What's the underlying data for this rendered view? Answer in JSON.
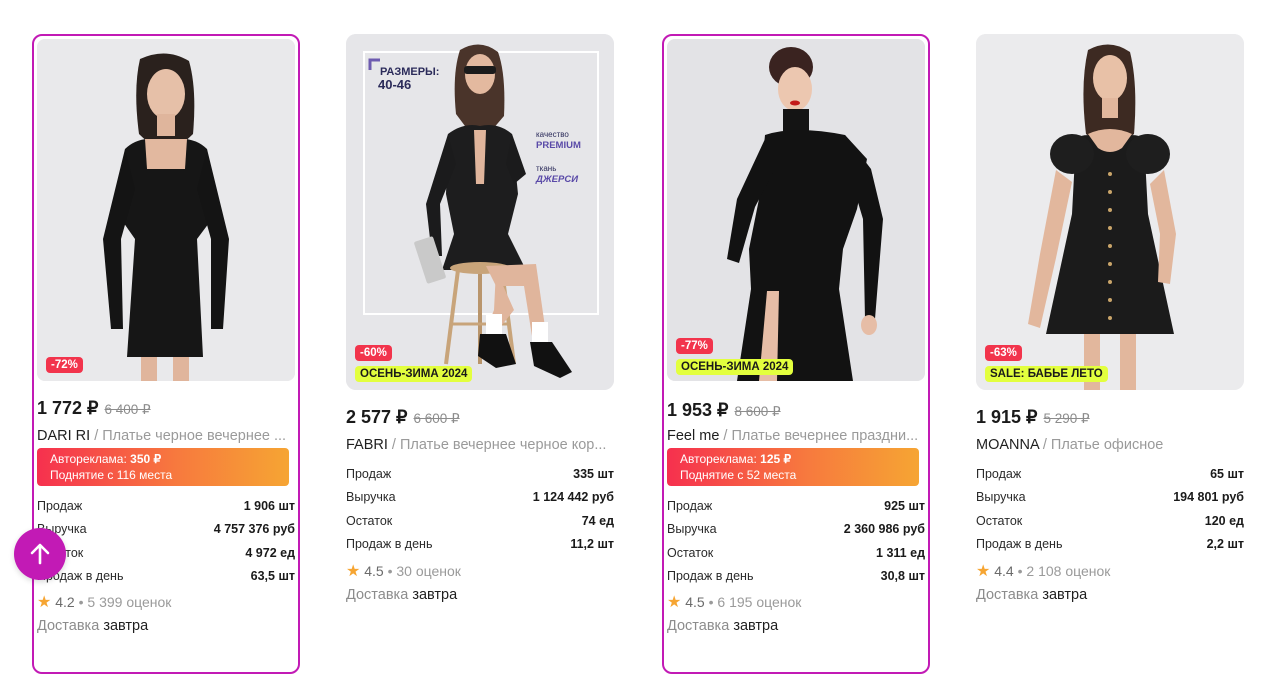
{
  "cards": [
    {
      "discount": "-72%",
      "tag": "",
      "price": "1 772 ₽",
      "old_price": "6 400 ₽",
      "brand": "DARI RI",
      "name": " / Платье черное вечернее ...",
      "ad": {
        "line1_prefix": "Автореклама: ",
        "line1_value": "350 ₽",
        "line2": "Поднятие с 116 места"
      },
      "stats": [
        {
          "label": "Продаж",
          "value": "1 906 шт"
        },
        {
          "label": "Выручка",
          "value": "4 757 376 руб"
        },
        {
          "label": "Остаток",
          "value": "4 972 ед"
        },
        {
          "label": "Продаж в день",
          "value": "63,5 шт"
        }
      ],
      "rating": {
        "score": "4.2",
        "count": "5 399 оценок"
      },
      "delivery": {
        "prefix": "Доставка",
        "when": "завтра"
      }
    },
    {
      "discount": "-60%",
      "tag": "ОСЕНЬ-ЗИМА 2024",
      "overlay": {
        "sizes_label": "РАЗМЕРЫ:",
        "sizes_value": "40-46",
        "quality_label": "качество",
        "quality_value": "PREMIUM",
        "fabric_label": "ткань",
        "fabric_value": "ДЖЕРСИ"
      },
      "price": "2 577 ₽",
      "old_price": "6 600 ₽",
      "brand": "FABRI",
      "name": " / Платье вечернее черное кор...",
      "stats": [
        {
          "label": "Продаж",
          "value": "335 шт"
        },
        {
          "label": "Выручка",
          "value": "1 124 442 руб"
        },
        {
          "label": "Остаток",
          "value": "74 ед"
        },
        {
          "label": "Продаж в день",
          "value": "11,2 шт"
        }
      ],
      "rating": {
        "score": "4.5",
        "count": "30 оценок"
      },
      "delivery": {
        "prefix": "Доставка",
        "when": "завтра"
      }
    },
    {
      "discount": "-77%",
      "tag": "ОСЕНЬ-ЗИМА 2024",
      "price": "1 953 ₽",
      "old_price": "8 600 ₽",
      "brand": "Feel me",
      "name": " / Платье вечернее праздни...",
      "ad": {
        "line1_prefix": "Автореклама: ",
        "line1_value": "125 ₽",
        "line2": "Поднятие с 52 места"
      },
      "stats": [
        {
          "label": "Продаж",
          "value": "925 шт"
        },
        {
          "label": "Выручка",
          "value": "2 360 986 руб"
        },
        {
          "label": "Остаток",
          "value": "1 311 ед"
        },
        {
          "label": "Продаж в день",
          "value": "30,8 шт"
        }
      ],
      "rating": {
        "score": "4.5",
        "count": "6 195 оценок"
      },
      "delivery": {
        "prefix": "Доставка",
        "when": "завтра"
      }
    },
    {
      "discount": "-63%",
      "tag": "SALE: БАБЬЕ ЛЕТО",
      "price": "1 915 ₽",
      "old_price": "5 290 ₽",
      "brand": "MOANNA",
      "name": " / Платье офисное",
      "stats": [
        {
          "label": "Продаж",
          "value": "65 шт"
        },
        {
          "label": "Выручка",
          "value": "194 801 руб"
        },
        {
          "label": "Остаток",
          "value": "120 ед"
        },
        {
          "label": "Продаж в день",
          "value": "2,2 шт"
        }
      ],
      "rating": {
        "score": "4.4",
        "count": "2 108 оценок"
      },
      "delivery": {
        "prefix": "Доставка",
        "when": "завтра"
      }
    }
  ],
  "colors": {
    "accent": "#c21ab5",
    "discount": "#f2344c",
    "tag": "#e3ff3e",
    "star": "#f6a532"
  },
  "scroll_up": {
    "icon": "arrow-up-icon"
  }
}
